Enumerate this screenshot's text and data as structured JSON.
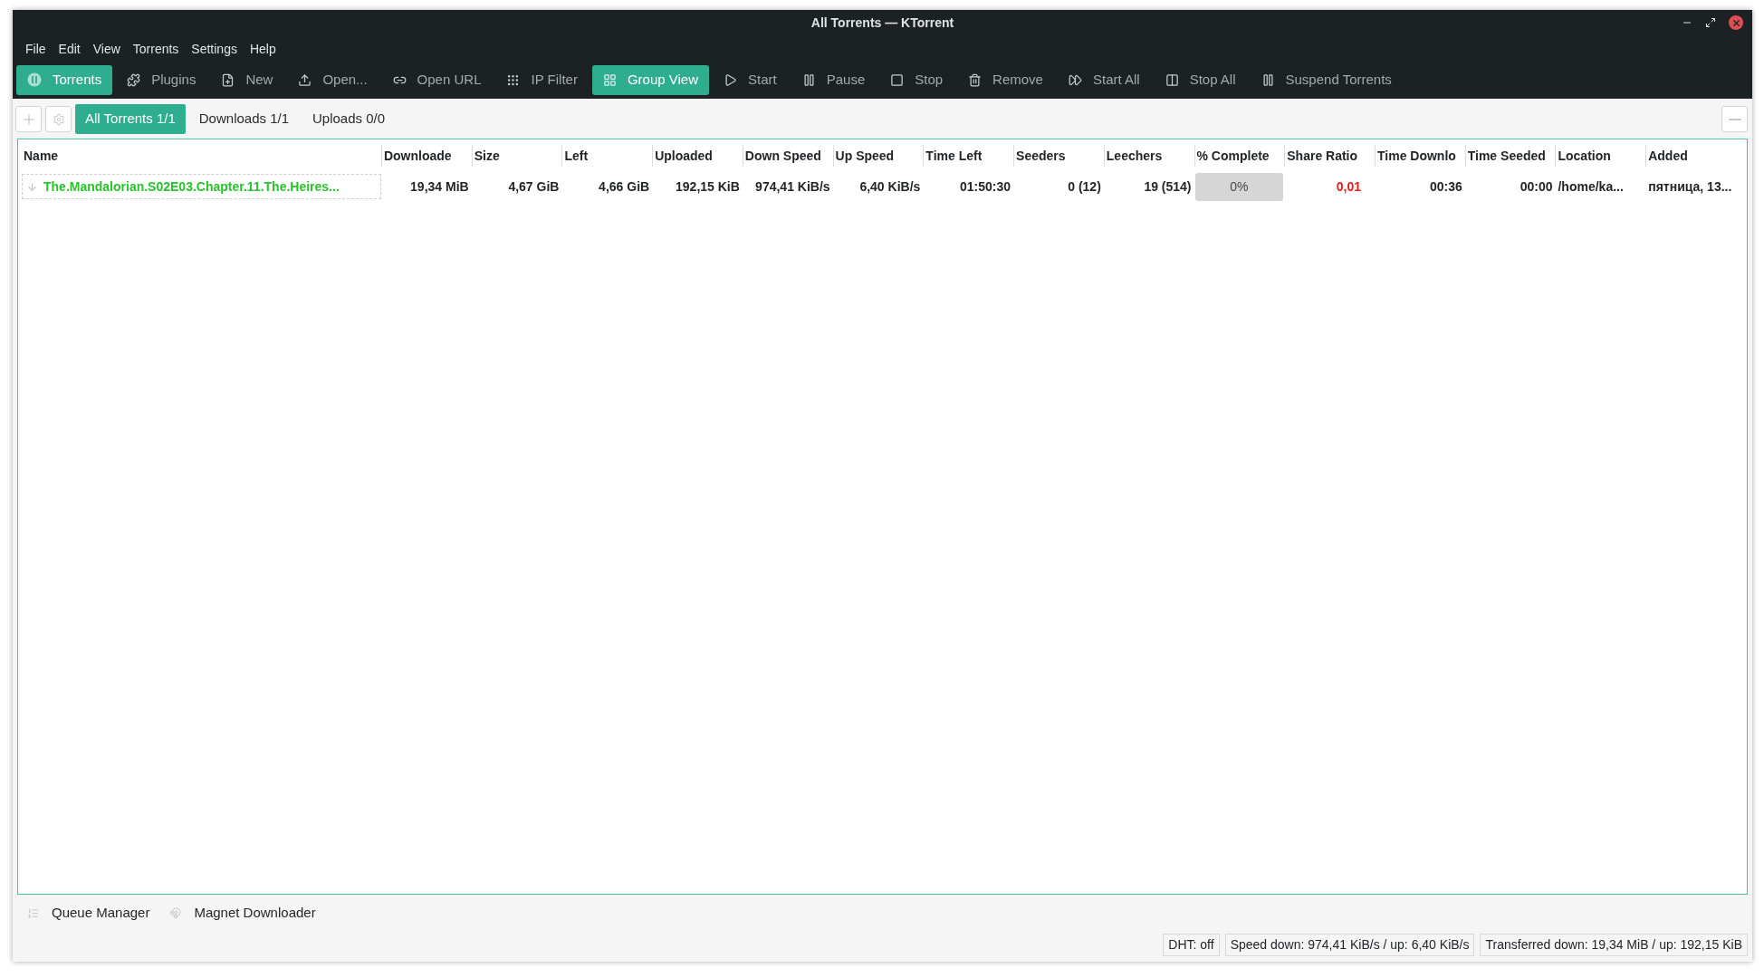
{
  "window": {
    "title": "All Torrents — KTorrent"
  },
  "menu": [
    "File",
    "Edit",
    "View",
    "Torrents",
    "Settings",
    "Help"
  ],
  "toolbar": [
    {
      "label": "Torrents",
      "selected": true
    },
    {
      "label": "Plugins",
      "selected": false
    },
    {
      "label": "New",
      "selected": false
    },
    {
      "label": "Open...",
      "selected": false
    },
    {
      "label": "Open URL",
      "selected": false
    },
    {
      "label": "IP Filter",
      "selected": false
    },
    {
      "label": "Group View",
      "selected": true
    },
    {
      "label": "Start",
      "selected": false
    },
    {
      "label": "Pause",
      "selected": false
    },
    {
      "label": "Stop",
      "selected": false
    },
    {
      "label": "Remove",
      "selected": false
    },
    {
      "label": "Start All",
      "selected": false
    },
    {
      "label": "Stop All",
      "selected": false
    },
    {
      "label": "Suspend Torrents",
      "selected": false
    }
  ],
  "tabs": [
    {
      "label": "All Torrents 1/1",
      "selected": true
    },
    {
      "label": "Downloads 1/1",
      "selected": false
    },
    {
      "label": "Uploads 0/0",
      "selected": false
    }
  ],
  "table": {
    "columns": [
      "Name",
      "Downloade",
      "Size",
      "Left",
      "Uploaded",
      "Down Speed",
      "Up Speed",
      "Time Left",
      "Seeders",
      "Leechers",
      "% Complete",
      "Share Ratio",
      "Time Downlo",
      "Time Seeded",
      "Location",
      "Added"
    ],
    "rows": [
      {
        "name": "The.Mandalorian.S02E03.Chapter.11.The.Heires...",
        "downloaded": "19,34 MiB",
        "size": "4,67 GiB",
        "left": "4,66 GiB",
        "uploaded": "192,15 KiB",
        "down_speed": "974,41 KiB/s",
        "up_speed": "6,40 KiB/s",
        "time_left": "01:50:30",
        "seeders": "0 (12)",
        "leechers": "19 (514)",
        "complete": "0%",
        "level": 0,
        "share_ratio": "0,01",
        "time_downloaded": "00:36",
        "time_seeded": "00:00",
        "location": "/home/ka...",
        "added": "пятница, 13..."
      }
    ]
  },
  "dock_tabs": [
    "Queue Manager",
    "Magnet Downloader"
  ],
  "status_bar": [
    "DHT: off",
    "Speed down: 974,41 KiB/s / up: 6,40 KiB/s",
    "Transferred down: 19,34 MiB / up: 192,15 KiB"
  ]
}
